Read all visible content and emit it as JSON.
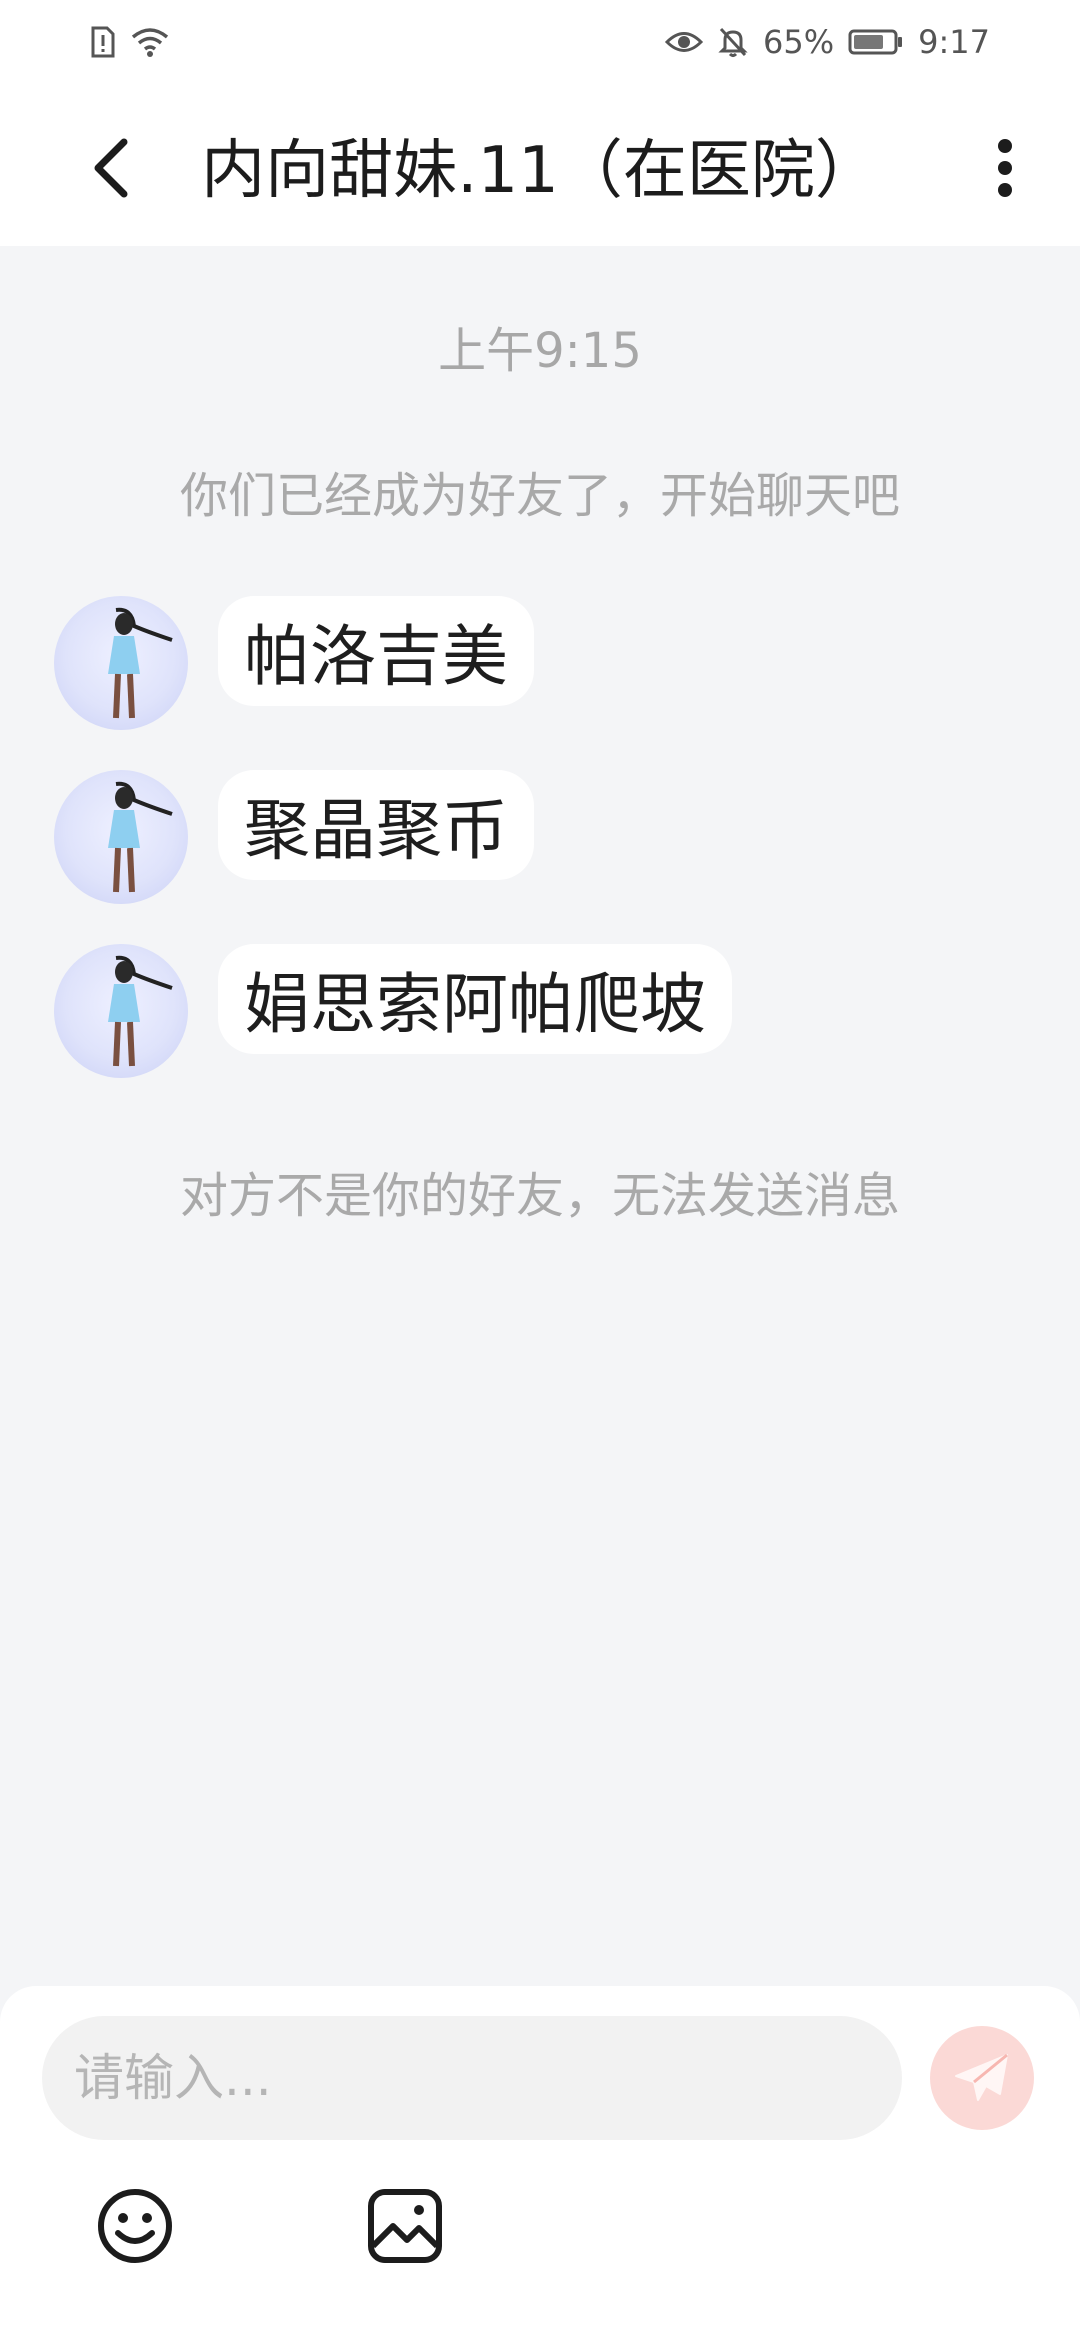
{
  "status_bar": {
    "battery_percent": "65%",
    "time": "9:17",
    "icons": [
      "sim-alert-icon",
      "wifi-icon",
      "eye-icon",
      "bell-off-icon",
      "battery-icon"
    ]
  },
  "header": {
    "title": "内向甜妹.11（在医院）",
    "back_icon": "chevron-left-icon",
    "more_icon": "more-vertical-icon"
  },
  "chat": {
    "timestamp": "上午9:15",
    "friend_notice": "你们已经成为好友了，开始聊天吧",
    "messages": [
      {
        "text": "帕洛吉美"
      },
      {
        "text": "聚晶聚币"
      },
      {
        "text": "娟思索阿帕爬坡"
      }
    ],
    "blocked_notice": "对方不是你的好友，无法发送消息"
  },
  "composer": {
    "placeholder": "请输入...",
    "send_icon": "send-icon",
    "emoji_icon": "emoji-icon",
    "image_icon": "image-icon",
    "send_color": "#f06a5e"
  }
}
